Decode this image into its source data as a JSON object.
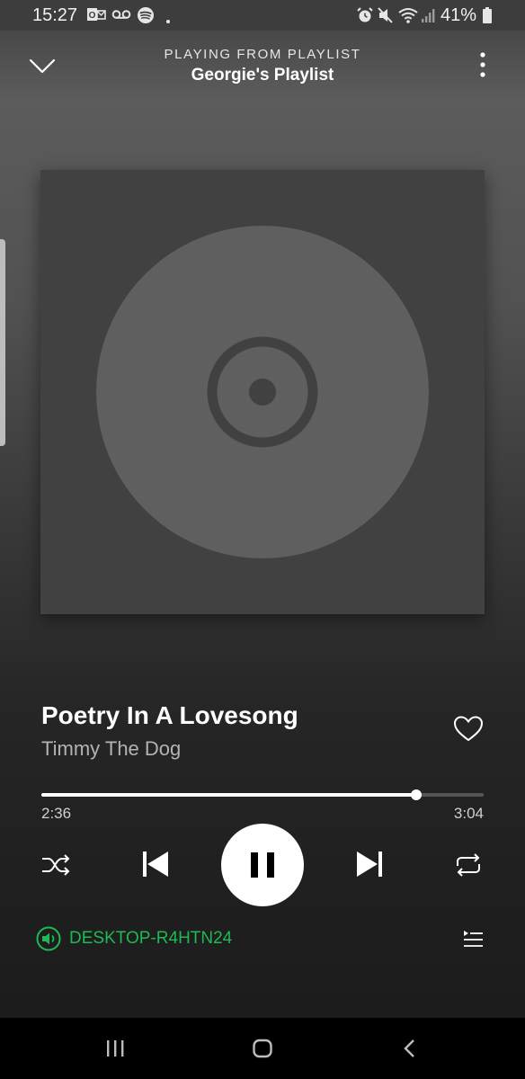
{
  "status_bar": {
    "time": "15:27",
    "battery": "41%",
    "icons": [
      "outlook-icon",
      "voicemail-icon",
      "spotify-icon",
      "dot-icon",
      "alarm-icon",
      "mute-icon",
      "wifi-icon",
      "signal-icon",
      "battery-icon"
    ]
  },
  "header": {
    "subtitle": "PLAYING FROM PLAYLIST",
    "playlist_name": "Georgie's Playlist"
  },
  "track": {
    "title": "Poetry In A Lovesong",
    "artist": "Timmy The Dog",
    "liked": false
  },
  "progress": {
    "elapsed": "2:36",
    "total": "3:04",
    "fraction": 0.848
  },
  "controls": [
    "shuffle-icon",
    "previous-icon",
    "pause-icon",
    "next-icon",
    "repeat-icon"
  ],
  "device": {
    "name": "DESKTOP-R4HTN24",
    "color": "#1db954"
  },
  "nav_bar": [
    "recent-apps-icon",
    "home-icon",
    "back-icon"
  ],
  "colors": {
    "accent": "#1db954",
    "background": "#1f1f1f",
    "artwork_bg": "#414141",
    "disc": "#5f5f5f"
  }
}
